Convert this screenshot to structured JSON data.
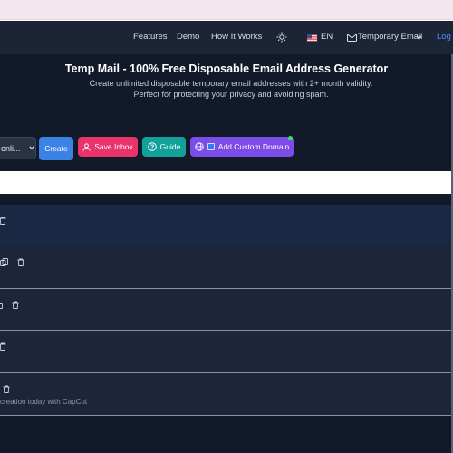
{
  "nav": {
    "items": [
      "Features",
      "Demo",
      "How It Works"
    ],
    "language": "EN",
    "menu": "Temporary Email",
    "login": "Log"
  },
  "hero": {
    "title": "Temp Mail - 100% Free Disposable Email Address Generator",
    "subtitle": "Create unlimited disposable temporary email addresses with 2+ month validity. Perfect for protecting your privacy and avoiding spam."
  },
  "controls": {
    "select_value": "onli...",
    "create_label": "Create",
    "save_label": "Save Inbox",
    "guide_label": "Guide",
    "domain_label": "Add Custom Domain"
  },
  "rows": [
    {
      "preview": ""
    },
    {
      "preview": ""
    },
    {
      "preview": ""
    },
    {
      "preview": ""
    },
    {
      "preview": "creation today with CapCut"
    }
  ],
  "colors": {
    "background": "#121a2a",
    "navbar": "#1c2535",
    "create": "#3b82e6",
    "save": "#e8336b",
    "guide": "#12a29a",
    "domain": "#7b4ce8"
  },
  "icons": [
    "sun-icon",
    "us-flag-icon",
    "mail-icon",
    "chevron-down-icon",
    "user-icon",
    "question-circle-icon",
    "globe-icon",
    "copy-icon",
    "trash-icon"
  ]
}
